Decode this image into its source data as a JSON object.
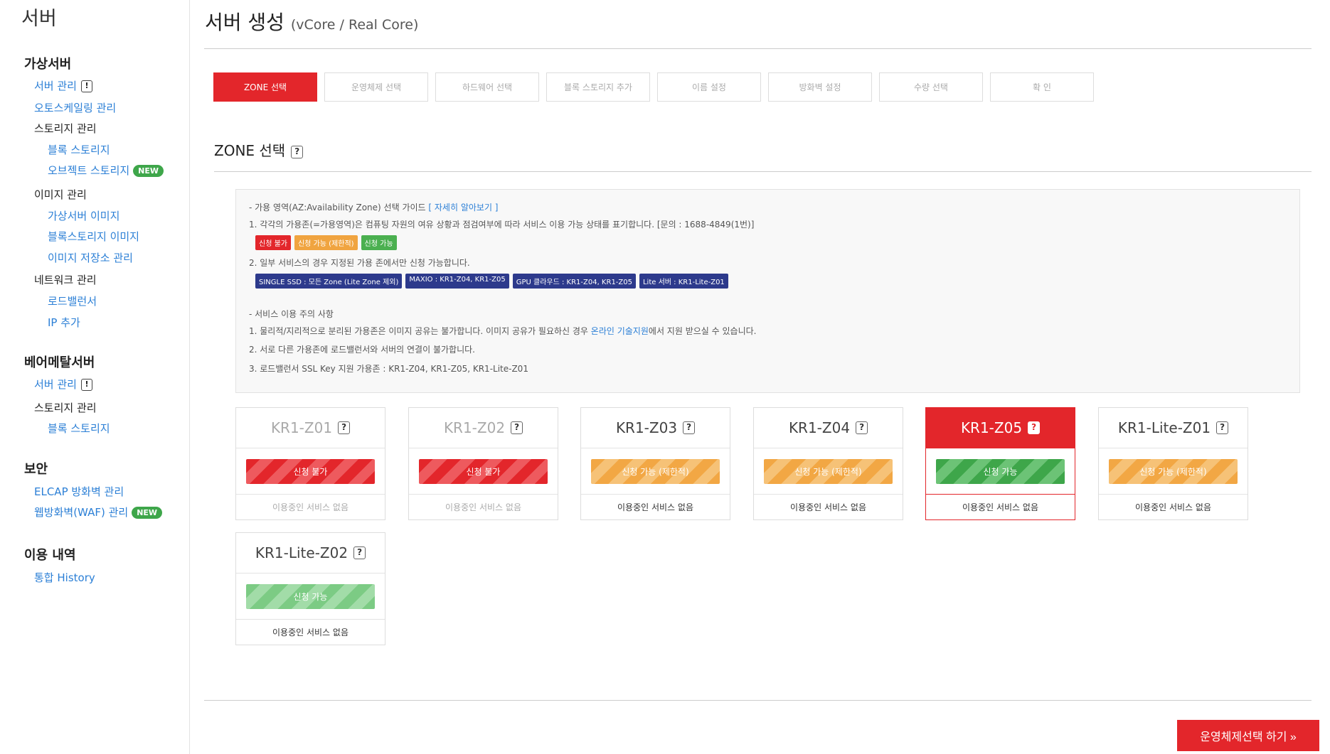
{
  "sidebar": {
    "title": "서버",
    "sections": {
      "virtual": {
        "label": "가상서버",
        "server_mgmt": "서버 관리",
        "autoscaling": "오토스케일링 관리",
        "storage_mgmt": "스토리지 관리",
        "block_storage": "블록 스토리지",
        "object_storage": "오브젝트 스토리지",
        "image_mgmt": "이미지 관리",
        "vm_image": "가상서버 이미지",
        "block_image": "블록스토리지 이미지",
        "image_repo": "이미지 저장소 관리",
        "network_mgmt": "네트워크 관리",
        "load_balancer": "로드밸런서",
        "ip_add": "IP 추가"
      },
      "baremetal": {
        "label": "베어메탈서버",
        "server_mgmt": "서버 관리",
        "storage_mgmt": "스토리지 관리",
        "block_storage": "블록 스토리지"
      },
      "security": {
        "label": "보안",
        "elcap": "ELCAP 방화벽 관리",
        "waf": "웹방화벽(WAF) 관리"
      },
      "usage": {
        "label": "이용 내역",
        "history": "통합 History"
      }
    },
    "new_badge": "NEW",
    "warn_glyph": "!"
  },
  "header": {
    "title": "서버 생성",
    "subtitle": "(vCore / Real Core)"
  },
  "steps": [
    "ZONE 선택",
    "운영체제 선택",
    "하드웨어 선택",
    "블록 스토리지 추가",
    "이름 설정",
    "방화벽 설정",
    "수량 선택",
    "확  인"
  ],
  "section": {
    "title": "ZONE 선택",
    "help_glyph": "?"
  },
  "guide": {
    "az_title": "- 가용 영역(AZ:Availability Zone) 선택 가이드",
    "az_link": "[ 자세히 알아보기 ]",
    "line1": "1. 각각의 가용존(=가용영역)은 컴퓨팅 자원의 여유 상황과 점검여부에 따라 서비스 이용 가능 상태를 표기합니다. [문의 : 1688-4849(1번)]",
    "status_chips": [
      "신청 불가",
      "신청 가능 (제한적)",
      "신청 가능"
    ],
    "line2": "2. 일부 서비스의 경우 지정된 가용 존에서만 신청 가능합니다.",
    "service_chips": [
      "SINGLE SSD : 모든 Zone (Lite Zone 제외)",
      "MAXIO : KR1-Z04, KR1-Z05",
      "GPU 클라우드 : KR1-Z04, KR1-Z05",
      "Lite 서버 : KR1-Lite-Z01"
    ],
    "notice_title": "- 서비스 이용 주의 사항",
    "notice1_pre": "1. 물리적/지리적으로 분리된 가용존은 이미지 공유는 불가합니다. 이미지 공유가 필요하신 경우 ",
    "notice1_link": "온라인 기술지원",
    "notice1_post": "에서 지원 받으실 수 있습니다.",
    "notice2": "2. 서로 다른 가용존에 로드밸런서와 서버의 연결이 불가합니다.",
    "notice3": "3. 로드밸런서 SSL Key 지원 가용존 : KR1-Z04, KR1-Z05, KR1-Lite-Z01"
  },
  "zones": [
    {
      "name": "KR1-Z01",
      "status": "신청 불가",
      "status_type": "unavailable",
      "usage": "이용중인 서비스 없음"
    },
    {
      "name": "KR1-Z02",
      "status": "신청 불가",
      "status_type": "unavailable",
      "usage": "이용중인 서비스 없음"
    },
    {
      "name": "KR1-Z03",
      "status": "신청 가능 (제한적)",
      "status_type": "limited",
      "usage": "이용중인 서비스 없음"
    },
    {
      "name": "KR1-Z04",
      "status": "신청 가능 (제한적)",
      "status_type": "limited",
      "usage": "이용중인 서비스 없음"
    },
    {
      "name": "KR1-Z05",
      "status": "신청 가능",
      "status_type": "available",
      "usage": "이용중인 서비스 없음",
      "selected": true
    },
    {
      "name": "KR1-Lite-Z01",
      "status": "신청 가능 (제한적)",
      "status_type": "limited",
      "usage": "이용중인 서비스 없음"
    },
    {
      "name": "KR1-Lite-Z02",
      "status": "신청 가능",
      "status_type": "available",
      "usage": "이용중인 서비스 없음"
    }
  ],
  "next_button": "운영체제선택 하기 »",
  "colors": {
    "accent": "#e3262b",
    "link": "#2b7fd6",
    "available": "#3ea64a",
    "limited": "#f2a744",
    "service_chip": "#2d3a8c"
  }
}
